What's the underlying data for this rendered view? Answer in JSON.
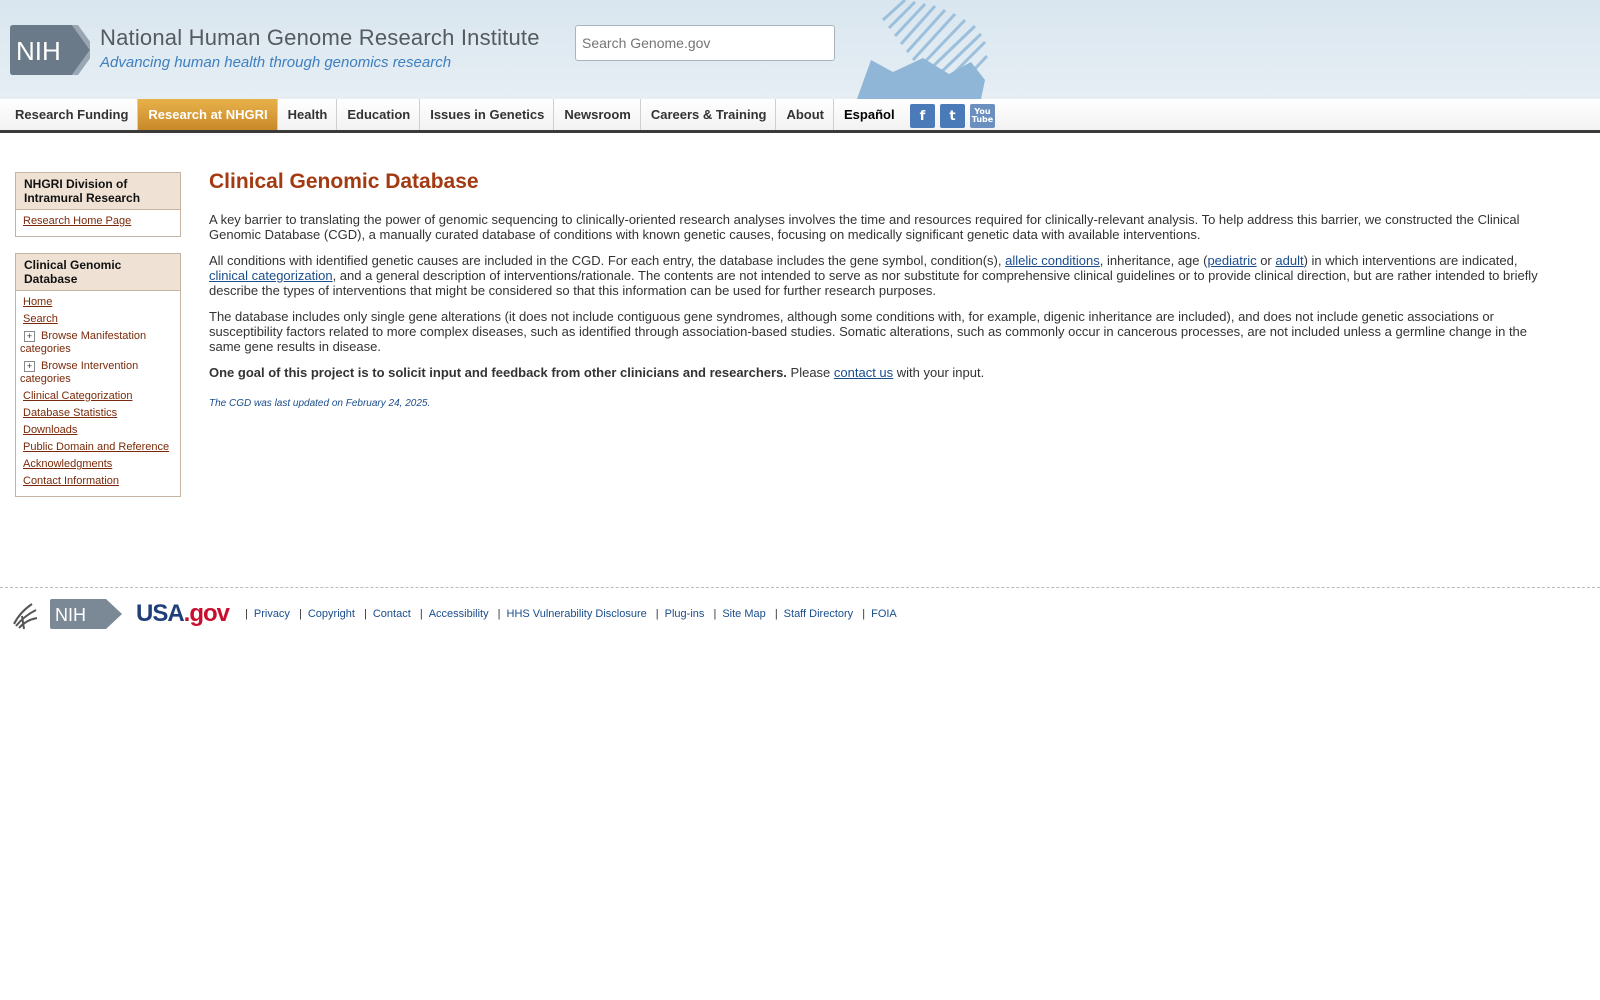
{
  "header": {
    "org_name": "National Human Genome Research Institute",
    "tagline": "Advancing human health through genomics research",
    "nih_badge": "NIH",
    "search_placeholder": "Search Genome.gov"
  },
  "nav": {
    "items": [
      {
        "label": "Research Funding"
      },
      {
        "label": "Research at NHGRI"
      },
      {
        "label": "Health"
      },
      {
        "label": "Education"
      },
      {
        "label": "Issues in Genetics"
      },
      {
        "label": "Newsroom"
      },
      {
        "label": "Careers & Training"
      },
      {
        "label": "About"
      },
      {
        "label": "Español"
      }
    ],
    "active_index": 1,
    "social_icons": [
      "facebook-icon",
      "twitter-icon",
      "youtube-icon"
    ],
    "social": {
      "facebook": "f",
      "twitter": "t",
      "youtube": "You Tube"
    }
  },
  "sidebar": {
    "box1": {
      "title": "NHGRI Division of Intramural Research",
      "links": [
        "Research Home Page"
      ]
    },
    "box2": {
      "title": "Clinical Genomic Database",
      "links": [
        "Home",
        "Search"
      ],
      "expanders": [
        "Browse Manifestation categories",
        "Browse Intervention categories"
      ],
      "links2": [
        "Clinical Categorization",
        "Database Statistics",
        "Downloads",
        "Public Domain and Reference",
        "Acknowledgments",
        "Contact Information"
      ]
    }
  },
  "main": {
    "title": "Clinical Genomic Database",
    "p1": "A key barrier to translating the power of genomic sequencing to clinically-oriented research analyses involves the time and resources required for clinically-relevant analysis. To help address this barrier, we constructed the Clinical Genomic Database (CGD), a manually curated database of conditions with known genetic causes, focusing on medically significant genetic data with available interventions.",
    "p2": {
      "t1": "All conditions with identified genetic causes are included in the CGD. For each entry, the database includes the gene symbol, condition(s), ",
      "l1": "allelic conditions",
      "t2": ", inheritance, age (",
      "l2": "pediatric",
      "t3": " or ",
      "l3": "adult",
      "t4": ") in which interventions are indicated, ",
      "l4": "clinical categorization",
      "t5": ", and a general description of interventions/rationale. The contents are not intended to serve as nor substitute for comprehensive clinical guidelines or to provide clinical direction, but are rather intended to briefly describe the types of interventions that might be considered so that this information can be used for further research purposes."
    },
    "p3": "The database includes only single gene alterations (it does not include contiguous gene syndromes, although some conditions with, for example, digenic inheritance are included), and does not include genetic associations or susceptibility factors related to more complex diseases, such as identified through association-based studies. Somatic alterations, such as commonly occur in cancerous processes, are not included unless a germline change in the same gene results in disease.",
    "p4": {
      "bold": "One goal of this project is to solicit input and feedback from other clinicians and researchers.",
      "t1": " Please ",
      "link": "contact us",
      "t2": " with your input."
    },
    "updated": "The CGD was last updated on February 24, 2025."
  },
  "footer": {
    "nih": "NIH",
    "usagov": {
      "a": "USA",
      "b": ".gov"
    },
    "links": [
      "Privacy",
      "Copyright",
      "Contact",
      "Accessibility",
      "HHS Vulnerability Disclosure",
      "Plug-ins",
      "Site Map",
      "Staff Directory",
      "FOIA"
    ]
  },
  "colors": {
    "nav_active": "#d99a36",
    "title": "#a33a12",
    "sidebar_head": "#efe2d5",
    "link": "#1a4d8c"
  }
}
